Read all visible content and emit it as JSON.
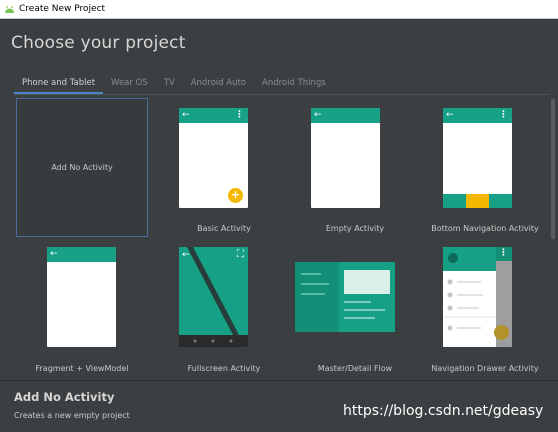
{
  "window": {
    "title": "Create New Project"
  },
  "heading": "Choose your project",
  "tabs": [
    {
      "label": "Phone and Tablet",
      "active": true
    },
    {
      "label": "Wear OS",
      "active": false
    },
    {
      "label": "TV",
      "active": false
    },
    {
      "label": "Android Auto",
      "active": false
    },
    {
      "label": "Android Things",
      "active": false
    }
  ],
  "templates": [
    {
      "label": "Add No Activity",
      "selected": true
    },
    {
      "label": "Basic Activity"
    },
    {
      "label": "Empty Activity"
    },
    {
      "label": "Bottom Navigation Activity"
    },
    {
      "label": "Fragment + ViewModel"
    },
    {
      "label": "Fullscreen Activity"
    },
    {
      "label": "Master/Detail Flow"
    },
    {
      "label": "Navigation Drawer Activity"
    }
  ],
  "icons": {
    "back": "←",
    "menu": "⋮",
    "fab_plus": "+",
    "fullscreen": "⛶"
  },
  "details": {
    "title": "Add No Activity",
    "description": "Creates a new empty project"
  },
  "watermark": "https://blog.csdn.net/gdeasy",
  "colors": {
    "accent": "#16a085",
    "fab": "#f5b800",
    "selection": "#4a6a9c"
  }
}
